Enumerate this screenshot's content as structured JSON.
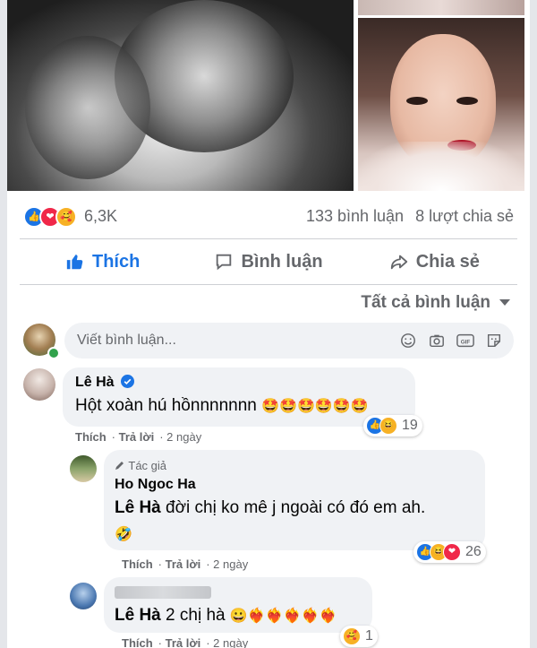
{
  "reactions": {
    "count": "6,3K",
    "comments": "133 bình luận",
    "shares": "8 lượt chia sẻ",
    "colors": {
      "like": "#1b74e4",
      "love": "#f02849",
      "care": "#f7b125"
    }
  },
  "actions": {
    "like": "Thích",
    "comment": "Bình luận",
    "share": "Chia sẻ"
  },
  "filter": {
    "label": "Tất cả bình luận"
  },
  "composer": {
    "placeholder": "Viết bình luận..."
  },
  "comments": [
    {
      "author": "Lê Hà",
      "text": "Hột xoàn hú hồnnnnnnn",
      "emoji": "🤩🤩🤩🤩🤩🤩",
      "like_label": "Thích",
      "reply_label": "Trả lời",
      "time": "2 ngày",
      "reaction_count": "19"
    },
    {
      "author_tag": "Tác giả",
      "author": "Ho Ngoc Ha",
      "mention": "Lê Hà",
      "text": " đời chị ko mê j ngoài có đó em ah.",
      "emoji": "🤣",
      "like_label": "Thích",
      "reply_label": "Trả lời",
      "time": "2 ngày",
      "reaction_count": "26"
    },
    {
      "mention": "Lê Hà",
      "text": " 2 chị hà",
      "emoji": "😀❤️‍🔥❤️‍🔥❤️‍🔥❤️‍🔥❤️‍🔥",
      "like_label": "Thích",
      "reply_label": "Trả lời",
      "time": "2 ngày",
      "reaction_count": "1"
    }
  ]
}
